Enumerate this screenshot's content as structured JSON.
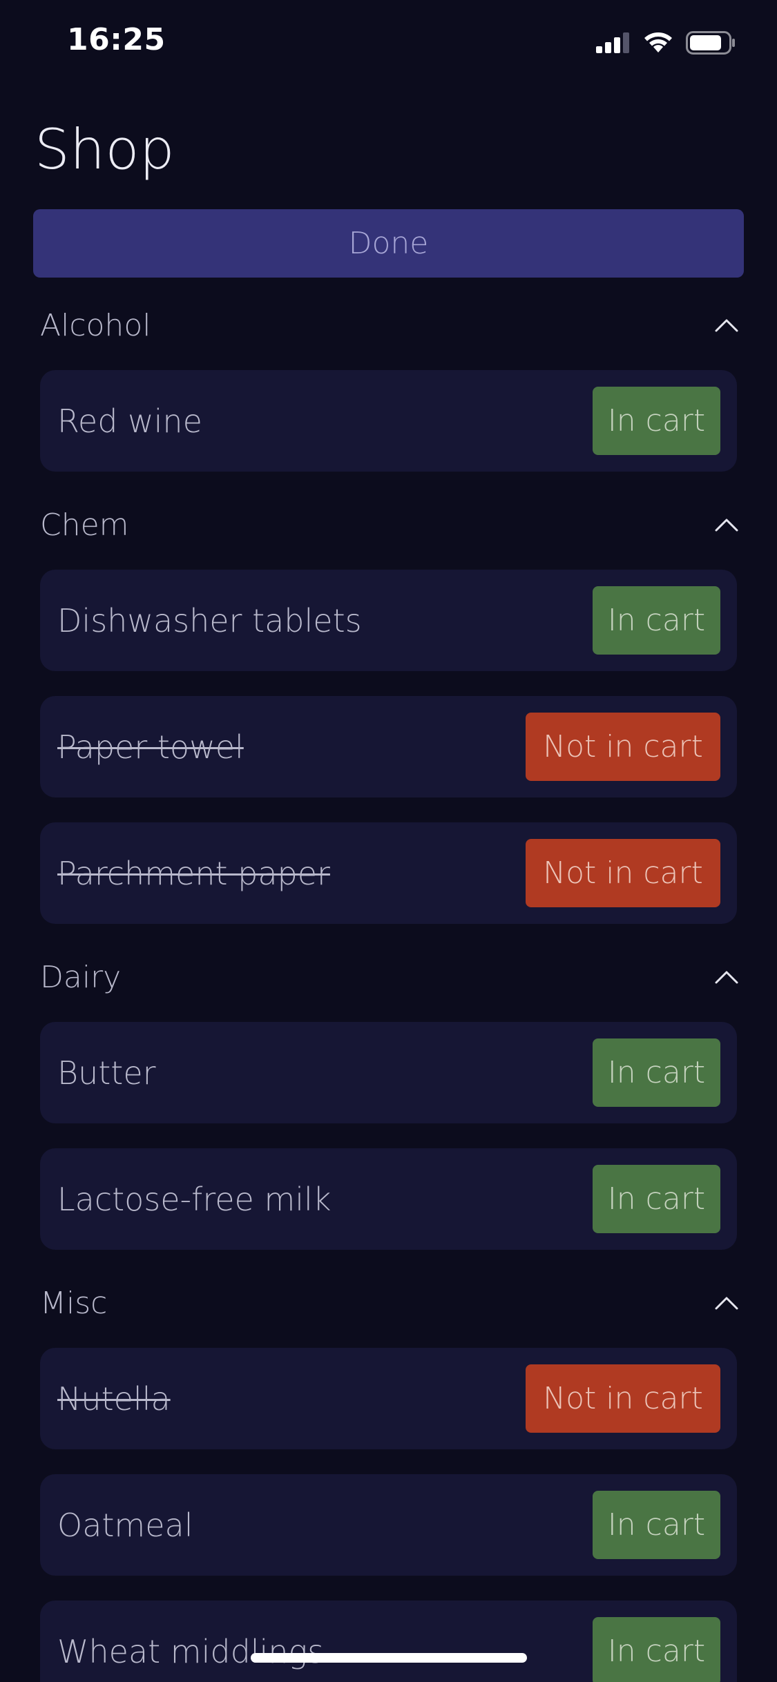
{
  "status_bar": {
    "time": "16:25",
    "icons": [
      "cellular-signal-icon",
      "wifi-icon",
      "battery-icon"
    ]
  },
  "header": {
    "title": "Shop",
    "done_label": "Done"
  },
  "colors": {
    "background": "#0c0c1d",
    "card": "#161634",
    "done_button": "#343378",
    "in_cart": "#4a7544",
    "not_in_cart": "#b03a22"
  },
  "sections": [
    {
      "title": "Alcohol",
      "expanded_icon": "chevron-up-icon",
      "items": [
        {
          "name": "Red wine",
          "status": "In cart",
          "in_cart": true
        }
      ]
    },
    {
      "title": "Chem",
      "expanded_icon": "chevron-up-icon",
      "items": [
        {
          "name": "Dishwasher tablets",
          "status": "In cart",
          "in_cart": true
        },
        {
          "name": "Paper towel",
          "status": "Not in cart",
          "in_cart": false
        },
        {
          "name": "Parchment paper",
          "status": "Not in cart",
          "in_cart": false
        }
      ]
    },
    {
      "title": "Dairy",
      "expanded_icon": "chevron-up-icon",
      "items": [
        {
          "name": "Butter",
          "status": "In cart",
          "in_cart": true
        },
        {
          "name": "Lactose-free milk",
          "status": "In cart",
          "in_cart": true
        }
      ]
    },
    {
      "title": "Misc",
      "expanded_icon": "chevron-up-icon",
      "items": [
        {
          "name": "Nutella",
          "status": "Not in cart",
          "in_cart": false
        },
        {
          "name": "Oatmeal",
          "status": "In cart",
          "in_cart": true
        },
        {
          "name": "Wheat middlings",
          "status": "In cart",
          "in_cart": true
        }
      ]
    }
  ]
}
